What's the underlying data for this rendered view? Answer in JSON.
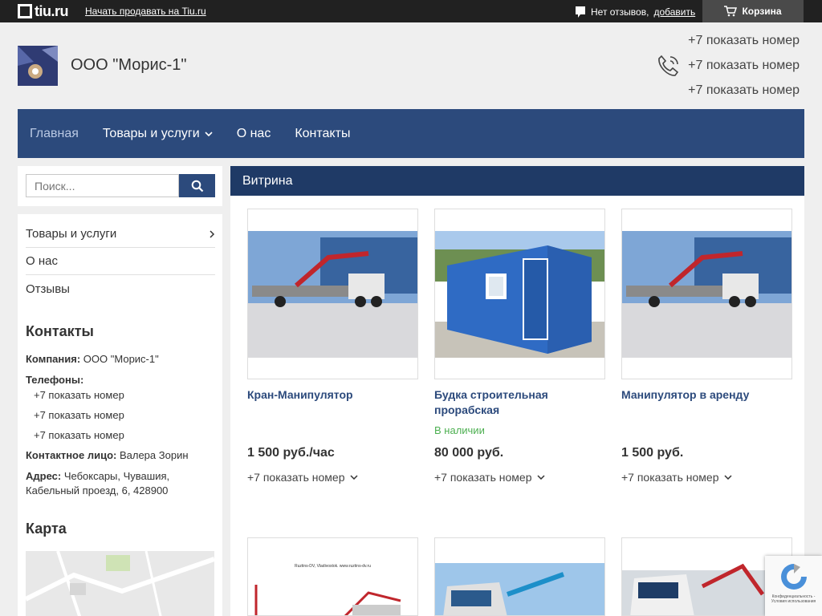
{
  "topbar": {
    "logo_text": "tiu.ru",
    "sell_link": "Начать продавать на Tiu.ru",
    "reviews_text": "Нет отзывов,",
    "reviews_add": "добавить",
    "cart_label": "Корзина"
  },
  "header": {
    "company_name": "ООО \"Морис-1\"",
    "phones": [
      "+7 показать номер",
      "+7 показать номер",
      "+7 показать номер"
    ]
  },
  "nav": {
    "items": [
      {
        "label": "Главная",
        "active": true
      },
      {
        "label": "Товары и услуги",
        "dropdown": true
      },
      {
        "label": "О нас"
      },
      {
        "label": "Контакты"
      }
    ]
  },
  "search": {
    "placeholder": "Поиск..."
  },
  "sidebar": {
    "menu": [
      "Товары и услуги",
      "О нас",
      "Отзывы"
    ],
    "contacts_title": "Контакты",
    "company_label": "Компания:",
    "company_value": "ООО \"Морис-1\"",
    "phones_label": "Телефоны:",
    "phones": [
      "+7 показать номер",
      "+7 показать номер",
      "+7 показать номер"
    ],
    "contact_person_label": "Контактное лицо:",
    "contact_person_value": "Валера Зорин",
    "address_label": "Адрес:",
    "address_value": "Чебоксары, Чувашия, Кабельный проезд, 6, 428900",
    "map_title": "Карта"
  },
  "main": {
    "title": "Витрина",
    "products": [
      {
        "name": "Кран-Манипулятор",
        "availability": "",
        "price": "1 500 руб./час",
        "phone": "+7 показать номер",
        "image": "truck-crane"
      },
      {
        "name": "Будка строительная прорабская",
        "availability": "В наличии",
        "price": "80 000 руб.",
        "phone": "+7 показать номер",
        "image": "blue-cabin"
      },
      {
        "name": "Манипулятор в аренду",
        "availability": "",
        "price": "1 500 руб.",
        "phone": "+7 показать номер",
        "image": "truck-crane"
      }
    ],
    "second_row_caption": "Ruztins-DV, Vladivostok. www.ruztins-dv.ru"
  },
  "recaptcha": {
    "text": "Конфиденциальность - Условия использования"
  },
  "colors": {
    "nav": "#2c4a7c",
    "topbar": "#212121",
    "header": "#1f3a66",
    "link": "#2c4a7c",
    "available": "#4caf50"
  }
}
